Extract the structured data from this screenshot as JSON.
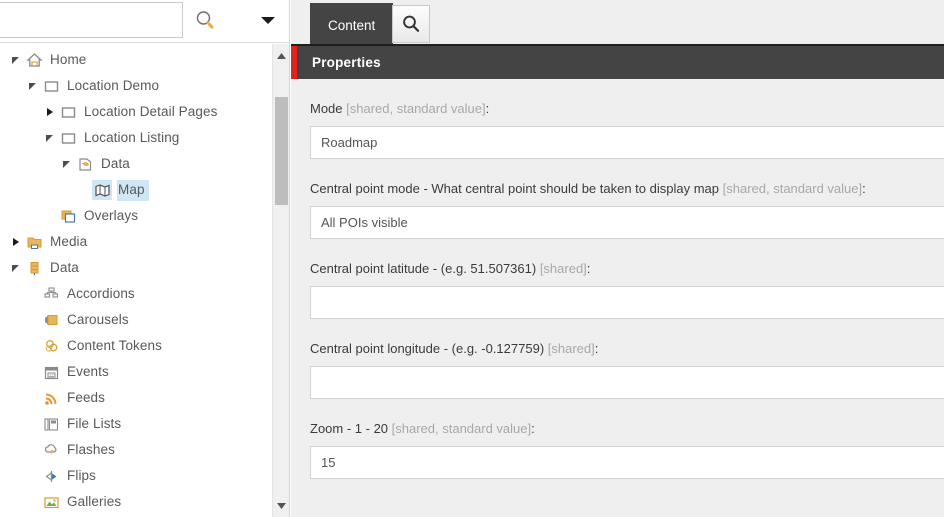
{
  "sidebar": {
    "search": {
      "value": "",
      "placeholder": ""
    },
    "search_icon": "search-icon",
    "dropdown_icon": "chevron-down-icon",
    "tree": [
      {
        "label": "Home",
        "icon": "home-icon",
        "depth": 0,
        "state": "expanded",
        "selected": false
      },
      {
        "label": "Location Demo",
        "icon": "page-icon",
        "depth": 1,
        "state": "expanded",
        "selected": false
      },
      {
        "label": "Location Detail Pages",
        "icon": "page-icon",
        "depth": 2,
        "state": "collapsed",
        "selected": false
      },
      {
        "label": "Location Listing",
        "icon": "page-icon",
        "depth": 2,
        "state": "expanded",
        "selected": false
      },
      {
        "label": "Data",
        "icon": "data-folder-icon",
        "depth": 3,
        "state": "expanded",
        "selected": false
      },
      {
        "label": "Map",
        "icon": "map-icon",
        "depth": 4,
        "state": "leaf",
        "selected": true
      },
      {
        "label": "Overlays",
        "icon": "overlays-icon",
        "depth": 2,
        "state": "leaf",
        "selected": false
      },
      {
        "label": "Media",
        "icon": "media-folder-icon",
        "depth": 0,
        "state": "collapsed",
        "selected": false
      },
      {
        "label": "Data",
        "icon": "database-icon",
        "depth": 0,
        "state": "expanded",
        "selected": false
      },
      {
        "label": "Accordions",
        "icon": "accordions-icon",
        "depth": 1,
        "state": "leaf",
        "selected": false
      },
      {
        "label": "Carousels",
        "icon": "carousels-icon",
        "depth": 1,
        "state": "leaf",
        "selected": false
      },
      {
        "label": "Content Tokens",
        "icon": "content-tokens-icon",
        "depth": 1,
        "state": "leaf",
        "selected": false
      },
      {
        "label": "Events",
        "icon": "calendar-icon",
        "depth": 1,
        "state": "leaf",
        "selected": false
      },
      {
        "label": "Feeds",
        "icon": "rss-icon",
        "depth": 1,
        "state": "leaf",
        "selected": false
      },
      {
        "label": "File Lists",
        "icon": "file-lists-icon",
        "depth": 1,
        "state": "leaf",
        "selected": false
      },
      {
        "label": "Flashes",
        "icon": "flash-icon",
        "depth": 1,
        "state": "leaf",
        "selected": false
      },
      {
        "label": "Flips",
        "icon": "flips-icon",
        "depth": 1,
        "state": "leaf",
        "selected": false
      },
      {
        "label": "Galleries",
        "icon": "galleries-icon",
        "depth": 1,
        "state": "leaf",
        "selected": false
      }
    ],
    "scrollbar": {
      "up_icon": "scroll-up-arrow-icon",
      "down_icon": "scroll-down-arrow-icon"
    }
  },
  "content": {
    "tabs": [
      {
        "label": "Content",
        "active": true
      }
    ],
    "tab_search_icon": "search-icon",
    "panel_title": "Properties",
    "accent_color": "#e2231a",
    "fields": [
      {
        "label": "Mode ",
        "annotation": "[shared, standard value]",
        "suffix": ":",
        "value": "Roadmap",
        "name": "mode-field"
      },
      {
        "label": "Central point mode - What central point should be taken to display map ",
        "annotation": "[shared, standard value]",
        "suffix": ":",
        "value": "All POIs visible",
        "name": "central-point-mode-field"
      },
      {
        "label": "Central point latitude - (e.g. 51.507361) ",
        "annotation": "[shared]",
        "suffix": ":",
        "value": "",
        "name": "central-point-latitude-field"
      },
      {
        "label": "Central point longitude - (e.g. -0.127759) ",
        "annotation": "[shared]",
        "suffix": ":",
        "value": "",
        "name": "central-point-longitude-field"
      },
      {
        "label": "Zoom - 1 - 20 ",
        "annotation": "[shared, standard value]",
        "suffix": ":",
        "value": "15",
        "name": "zoom-field"
      }
    ]
  }
}
